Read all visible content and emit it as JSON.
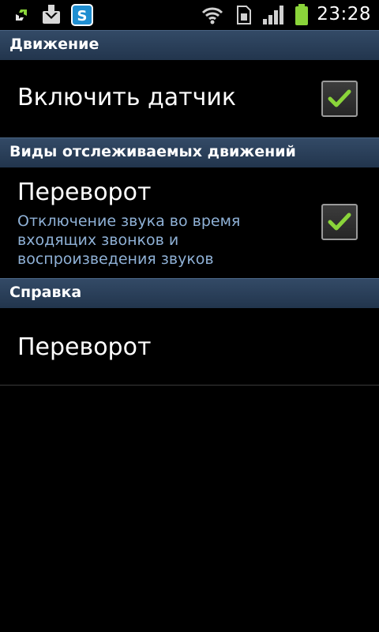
{
  "status_bar": {
    "time": "23:28",
    "icons": [
      "sync-arrows-icon",
      "download-icon",
      "skype-icon",
      "wifi-icon",
      "sim-card-icon",
      "signal-icon",
      "battery-icon"
    ]
  },
  "colors": {
    "category_bg": "#2a3f5a",
    "summary_text": "#8fb1d6",
    "check_green": "#8ad43a"
  },
  "sections": {
    "motion": {
      "header": "Движение",
      "enable_sensor": {
        "title": "Включить датчик",
        "checked": true
      }
    },
    "tracked_motions": {
      "header": "Виды отслеживаемых движений",
      "turn_over": {
        "title": "Переворот",
        "summary": "Отключение звука во время входящих звонков и воспроизведения звуков",
        "checked": true
      }
    },
    "help": {
      "header": "Справка",
      "turn_over": {
        "title": "Переворот"
      }
    }
  }
}
